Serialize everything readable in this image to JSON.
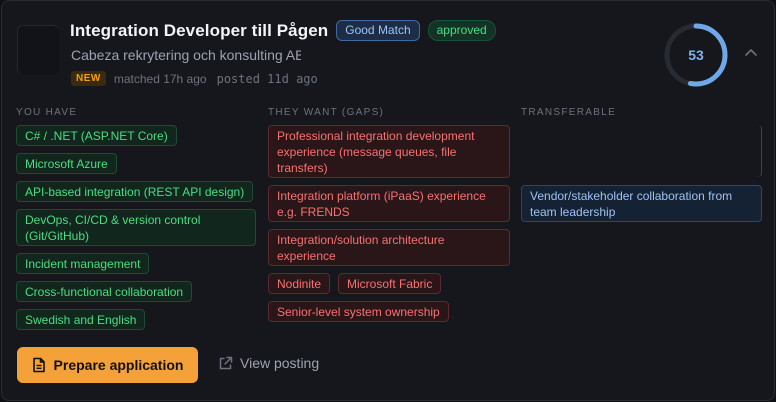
{
  "job": {
    "title": "Integration Developer till Pågen",
    "match_badge": "Good Match",
    "status_badge": "approved",
    "company": "Cabeza rekrytering och konsulting AB",
    "new_label": "NEW",
    "matched": "matched 17h ago",
    "posted": "posted 11d ago",
    "score": "53",
    "score_fraction": 0.53
  },
  "columns": {
    "have_title": "YOU HAVE",
    "want_title": "THEY WANT (GAPS)",
    "transferable_title": "TRANSFERABLE"
  },
  "have": [
    "C# / .NET (ASP.NET Core)",
    "Microsoft Azure",
    "API-based integration (REST API design)",
    "DevOps, CI/CD & version control (Git/GitHub)",
    "Incident management",
    "Cross-functional collaboration",
    "Swedish and English"
  ],
  "want": [
    "Professional integration development experience (message queues, file transfers)",
    "Integration platform (iPaaS) experience e.g. FRENDS",
    "Integration/solution architecture experience",
    "Nodinite",
    "Microsoft Fabric",
    "Senior-level system ownership"
  ],
  "transferable": [
    "Vendor/stakeholder collaboration from team leadership"
  ],
  "actions": {
    "prepare_label": "Prepare application",
    "view_label": "View posting"
  },
  "colors": {
    "accent": "#f4a13a",
    "have": "#4ade80",
    "want": "#f87171",
    "transferable": "#9cc3f5",
    "score_ring": "#6ea8e8"
  },
  "icons": {
    "prepare": "document-icon",
    "view": "external-link-icon",
    "collapse": "chevron-up-icon"
  }
}
